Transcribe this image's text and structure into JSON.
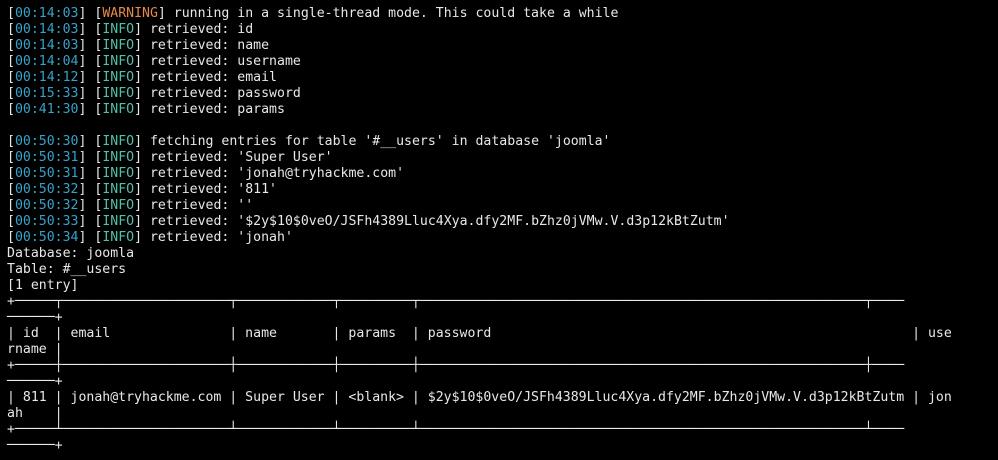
{
  "log_group_1": [
    {
      "time": "00:14:03",
      "level": "WARNING",
      "message": "running in a single-thread mode. This could take a while"
    },
    {
      "time": "00:14:03",
      "level": "INFO",
      "message": "retrieved: id"
    },
    {
      "time": "00:14:03",
      "level": "INFO",
      "message": "retrieved: name"
    },
    {
      "time": "00:14:04",
      "level": "INFO",
      "message": "retrieved: username"
    },
    {
      "time": "00:14:12",
      "level": "INFO",
      "message": "retrieved: email"
    },
    {
      "time": "00:15:33",
      "level": "INFO",
      "message": "retrieved: password"
    },
    {
      "time": "00:41:30",
      "level": "INFO",
      "message": "retrieved: params"
    }
  ],
  "log_group_2": [
    {
      "time": "00:50:30",
      "level": "INFO",
      "message": "fetching entries for table '#__users' in database 'joomla'"
    },
    {
      "time": "00:50:31",
      "level": "INFO",
      "message": "retrieved: 'Super User'"
    },
    {
      "time": "00:50:31",
      "level": "INFO",
      "message": "retrieved: 'jonah@tryhackme.com'"
    },
    {
      "time": "00:50:32",
      "level": "INFO",
      "message": "retrieved: '811'"
    },
    {
      "time": "00:50:32",
      "level": "INFO",
      "message": "retrieved: ''"
    },
    {
      "time": "00:50:33",
      "level": "INFO",
      "message": "retrieved: '$2y$10$0veO/JSFh4389Lluc4Xya.dfy2MF.bZhz0jVMw.V.d3p12kBtZutm'"
    },
    {
      "time": "00:50:34",
      "level": "INFO",
      "message": "retrieved: 'jonah'"
    }
  ],
  "result_info": {
    "database_line": "Database: joomla",
    "table_line": "Table: #__users",
    "entry_count": "[1 entry]"
  },
  "table_output": [
    "+─────┬─────────────────────┬────────────┬─────────┬────────────────────────────────────────────────────────┬────",
    "──────+",
    "| id  | email               | name       | params  | password                                                     | use",
    "rname |",
    "+─────┼─────────────────────┼────────────┼─────────┼────────────────────────────────────────────────────────┼────",
    "──────+",
    "| 811 | jonah@tryhackme.com | Super User | <blank> | $2y$10$0veO/JSFh4389Lluc4Xya.dfy2MF.bZhz0jVMw.V.d3p12kBtZutm | jon",
    "ah    |",
    "+─────┴─────────────────────┴────────────┴─────────┴────────────────────────────────────────────────────────┴────",
    "──────+"
  ],
  "colors": {
    "background": "#000000",
    "text": "#e8e8e8",
    "timestamp": "#35a3c9",
    "info": "#4fc1a8",
    "warning": "#e5894a"
  }
}
